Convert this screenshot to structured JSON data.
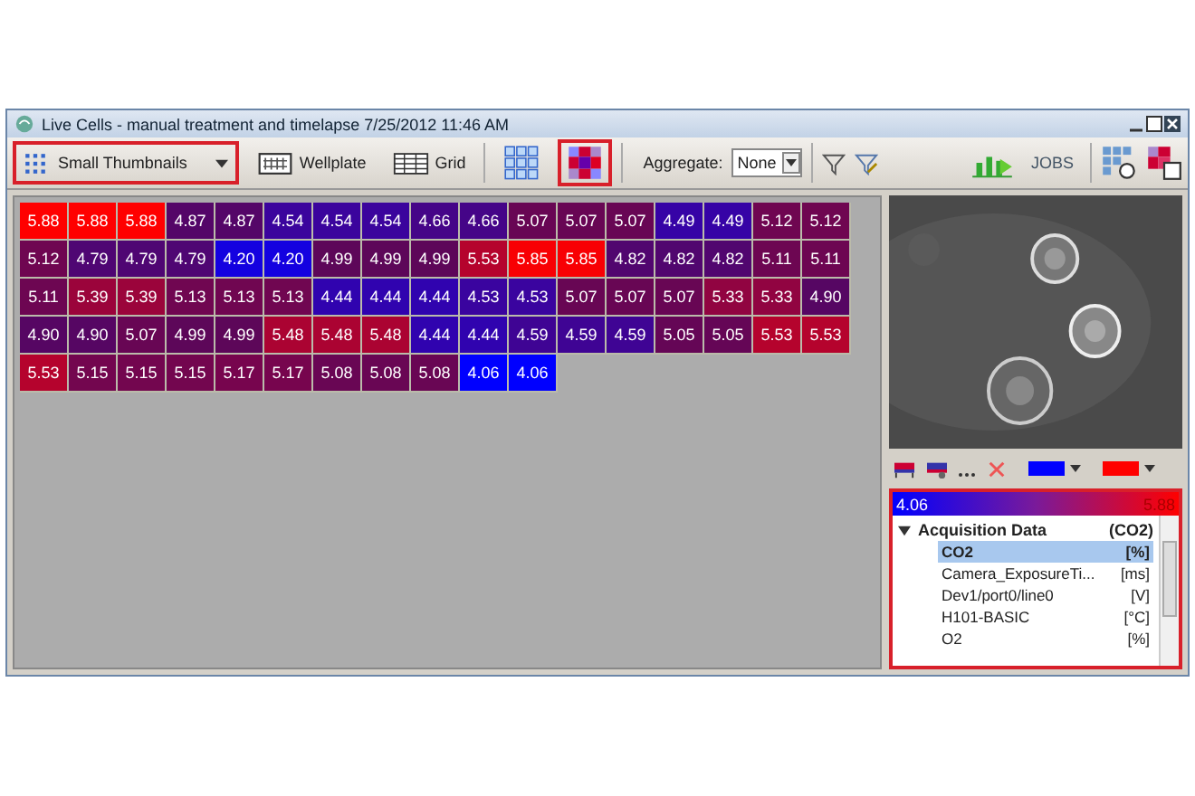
{
  "window": {
    "title": "Live Cells - manual treatment and timelapse 7/25/2012 11:46 AM"
  },
  "toolbar": {
    "view_mode": {
      "label": "Small Thumbnails",
      "highlighted": true
    },
    "buttons": [
      {
        "kind": "wellplate",
        "label": "Wellplate",
        "highlighted": false
      },
      {
        "kind": "grid",
        "label": "Grid",
        "highlighted": false
      },
      {
        "kind": "thumbs",
        "highlighted": false
      },
      {
        "kind": "heatmap",
        "highlighted": true
      }
    ],
    "aggregate": {
      "label": "Aggregate:",
      "value": "None"
    },
    "jobs": "JOBS"
  },
  "heatmap": {
    "rows": [
      [
        "5.88",
        "5.88",
        "5.88",
        "4.87",
        "4.87",
        "4.54",
        "4.54",
        "4.54",
        "4.66",
        "4.66",
        "5.07",
        "5.07",
        "5.07",
        "4.49",
        "4.49",
        "5.12",
        "5.12"
      ],
      [
        "5.12",
        "4.79",
        "4.79",
        "4.79",
        "4.20",
        "4.20",
        "4.99",
        "4.99",
        "4.99",
        "5.53",
        "5.85",
        "5.85",
        "4.82",
        "4.82",
        "4.82",
        "5.11",
        "5.11"
      ],
      [
        "5.11",
        "5.39",
        "5.39",
        "5.13",
        "5.13",
        "5.13",
        "4.44",
        "4.44",
        "4.44",
        "4.53",
        "4.53",
        "5.07",
        "5.07",
        "5.07",
        "5.33",
        "5.33",
        "4.90"
      ],
      [
        "4.90",
        "4.90",
        "5.07",
        "4.99",
        "4.99",
        "5.48",
        "5.48",
        "5.48",
        "4.44",
        "4.44",
        "4.59",
        "4.59",
        "4.59",
        "5.05",
        "5.05",
        "5.53",
        "5.53"
      ],
      [
        "5.53",
        "5.15",
        "5.15",
        "5.15",
        "5.17",
        "5.17",
        "5.08",
        "5.08",
        "5.08",
        "4.06",
        "4.06"
      ]
    ]
  },
  "side_panel": {
    "highlighted": true,
    "scale_min": "4.06",
    "scale_max": "5.88",
    "tree": {
      "label": "Acquisition Data",
      "unit": "(CO2)",
      "expanded": true,
      "children": [
        {
          "label": "CO2",
          "unit": "[%]",
          "selected": true
        },
        {
          "label": "Camera_ExposureTi...",
          "unit": "[ms]",
          "selected": false
        },
        {
          "label": "Dev1/port0/line0",
          "unit": "[V]",
          "selected": false
        },
        {
          "label": "H101-BASIC",
          "unit": "[°C]",
          "selected": false
        },
        {
          "label": "O2",
          "unit": "[%]",
          "selected": false
        }
      ]
    }
  }
}
